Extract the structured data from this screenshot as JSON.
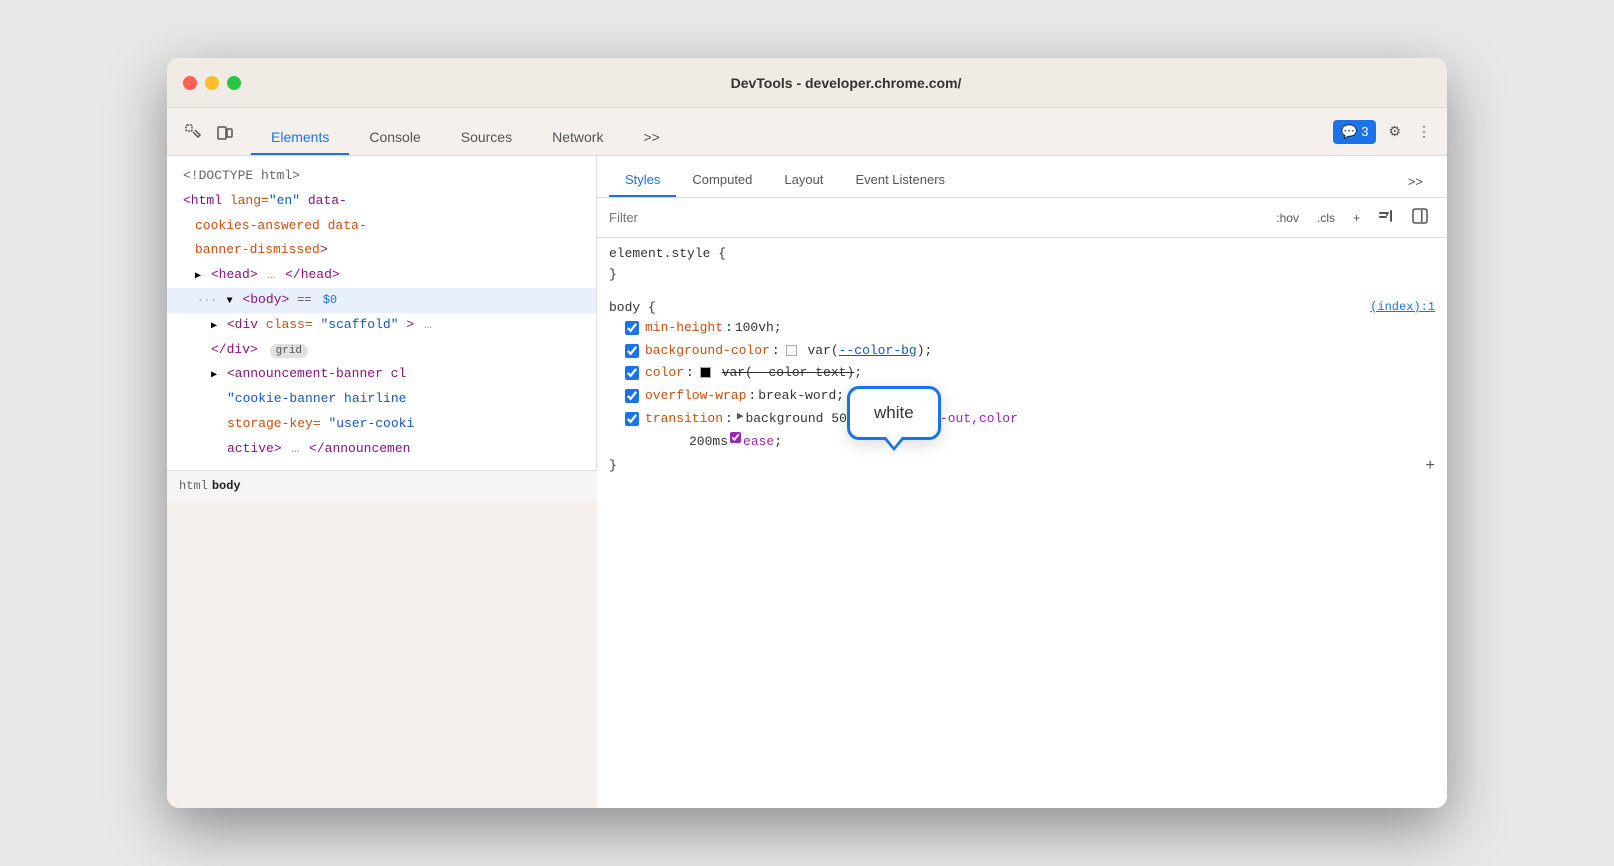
{
  "window": {
    "title": "DevTools - developer.chrome.com/"
  },
  "toolbar": {
    "tabs": [
      {
        "id": "elements",
        "label": "Elements",
        "active": true
      },
      {
        "id": "console",
        "label": "Console",
        "active": false
      },
      {
        "id": "sources",
        "label": "Sources",
        "active": false
      },
      {
        "id": "network",
        "label": "Network",
        "active": false
      },
      {
        "id": "more",
        "label": ">>",
        "active": false
      }
    ],
    "badge_label": "3",
    "settings_icon": "⚙",
    "more_icon": "⋮"
  },
  "elements_panel": {
    "lines": [
      {
        "id": "doctype",
        "indent": 0,
        "text": "<!DOCTYPE html>",
        "type": "comment"
      },
      {
        "id": "html_tag",
        "indent": 0,
        "text": "<html lang=\"en\" data-cookies-answered data-banner-dismissed>",
        "type": "tag"
      },
      {
        "id": "head_tag",
        "indent": 1,
        "text": "▶ <head>",
        "type": "tag",
        "ellipsis": true,
        "close": "</head>"
      },
      {
        "id": "body_tag",
        "indent": 1,
        "text": "▼ <body>",
        "type": "tag",
        "selected": true,
        "equals": "== $0"
      },
      {
        "id": "div_scaffold",
        "indent": 2,
        "text": "▶ <div class=\"scaffold\">",
        "type": "tag",
        "truncated": true
      },
      {
        "id": "div_close",
        "indent": 2,
        "text": "</div>",
        "type": "tag",
        "badge": "grid"
      },
      {
        "id": "announcement",
        "indent": 2,
        "text": "▶ <announcement-banner cl",
        "type": "tag",
        "truncated": true
      },
      {
        "id": "cookie_banner",
        "indent": 3,
        "text": "\"cookie-banner hairline",
        "type": "attr"
      },
      {
        "id": "storage_key",
        "indent": 3,
        "text": "storage-key=\"user-cooki",
        "type": "attr"
      },
      {
        "id": "active_close",
        "indent": 3,
        "text": "active>",
        "type": "tag",
        "ellipsis": true,
        "close": "</announcement"
      }
    ]
  },
  "breadcrumb": {
    "items": [
      "html",
      "body"
    ]
  },
  "styles_panel": {
    "tabs": [
      {
        "id": "styles",
        "label": "Styles",
        "active": true
      },
      {
        "id": "computed",
        "label": "Computed",
        "active": false
      },
      {
        "id": "layout",
        "label": "Layout",
        "active": false
      },
      {
        "id": "event-listeners",
        "label": "Event Listeners",
        "active": false
      },
      {
        "id": "more",
        "label": ">>",
        "active": false
      }
    ],
    "filter_placeholder": "Filter",
    "hov_label": ":hov",
    "cls_label": ".cls",
    "rules": [
      {
        "id": "element-style",
        "selector": "element.style {",
        "close": "}",
        "properties": []
      },
      {
        "id": "body-rule",
        "selector": "body {",
        "source": "(index):1",
        "close": "}",
        "properties": [
          {
            "id": "min-height",
            "checked": true,
            "name": "min-height",
            "value": "100vh",
            "semicolon": ";"
          },
          {
            "id": "background-color",
            "checked": true,
            "name": "background-color",
            "value_prefix": "",
            "swatch": "white",
            "value": "var(--color-bg)",
            "semicolon": ";",
            "has_swatch": true
          },
          {
            "id": "color",
            "checked": true,
            "name": "color",
            "value_prefix": "",
            "swatch": "black",
            "value": "var(--color-text)",
            "semicolon": ";",
            "has_swatch": true,
            "strikethrough": true
          },
          {
            "id": "overflow-wrap",
            "checked": true,
            "name": "overflow-wrap",
            "value": "break-word",
            "semicolon": ";"
          },
          {
            "id": "transition",
            "checked": true,
            "name": "transition",
            "value": "background 500ms",
            "ease1": "ease-in-out,color",
            "value2": "200ms",
            "ease2": "ease",
            "semicolon": ";"
          }
        ]
      }
    ],
    "tooltip": {
      "text": "white",
      "visible": true
    }
  }
}
